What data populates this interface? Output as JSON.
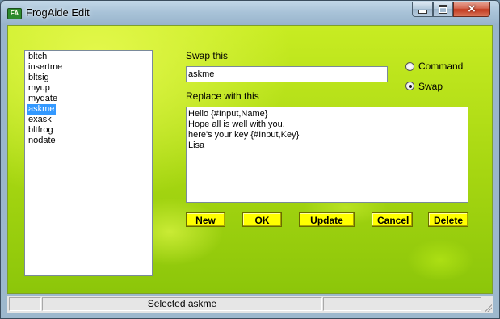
{
  "window": {
    "title": "FrogAide Edit",
    "app_icon_text": "FA",
    "controls": {
      "minimize": "minimize",
      "maximize": "maximize",
      "close": "×"
    }
  },
  "list": {
    "items": [
      {
        "label": "bltch"
      },
      {
        "label": "insertme"
      },
      {
        "label": "bltsig"
      },
      {
        "label": "myup"
      },
      {
        "label": "mydate"
      },
      {
        "label": "askme"
      },
      {
        "label": "exask"
      },
      {
        "label": "bltfrog"
      },
      {
        "label": "nodate"
      }
    ],
    "selected_index": 5
  },
  "form": {
    "swap_label": "Swap this",
    "swap_value": "askme",
    "replace_label": "Replace with this",
    "replace_lines": [
      "Hello {#Input,Name}",
      "Hope all is well with you.",
      "here's your key {#Input,Key}",
      "Lisa"
    ]
  },
  "mode": {
    "options": [
      {
        "label": "Command",
        "checked": false
      },
      {
        "label": "Swap",
        "checked": true
      }
    ]
  },
  "buttons": {
    "new": "New",
    "ok": "OK",
    "update": "Update",
    "cancel": "Cancel",
    "delete": "Delete"
  },
  "status": {
    "pane1": "",
    "pane2": "Selected askme",
    "pane3": ""
  },
  "colors": {
    "accent_button": "#ffff00",
    "selection": "#3399ff",
    "background_green": "#a6d611"
  }
}
